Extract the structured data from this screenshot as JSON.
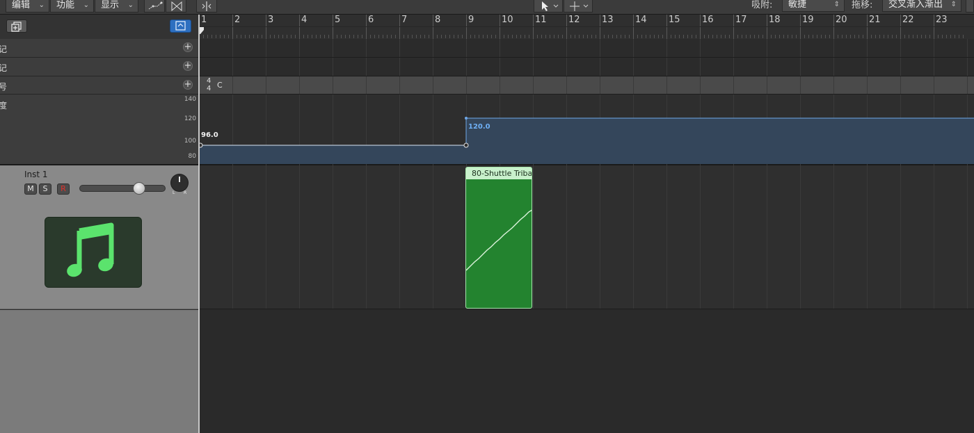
{
  "toolbar": {
    "menus": [
      {
        "label": "编辑"
      },
      {
        "label": "功能"
      },
      {
        "label": "显示"
      }
    ],
    "snap_label": "吸附:",
    "snap_value": "敏捷",
    "drag_label": "拖移:",
    "drag_value": "交叉渐入渐出"
  },
  "ruler": {
    "bars": [
      "1",
      "2",
      "3",
      "4",
      "5",
      "6",
      "7",
      "8",
      "9",
      "10",
      "11",
      "12",
      "13",
      "14",
      "15",
      "16",
      "17",
      "18",
      "19",
      "20",
      "21",
      "22",
      "23"
    ]
  },
  "global_tracks": {
    "row1_label": "记",
    "row2_label": "记",
    "row3_label": "号",
    "row4_label": "度",
    "signature_top": "4",
    "signature_bottom": "4",
    "key": "C",
    "tempo_ticks": [
      "140",
      "120",
      "100",
      "80"
    ],
    "tempo_start": "96.0",
    "tempo_change": "120.0"
  },
  "track": {
    "name": "Inst 1",
    "mute": "M",
    "solo": "S",
    "record": "R",
    "pan_left": "L",
    "pan_right": "R",
    "volume_level": 0.86
  },
  "region": {
    "name": "80-Shuttle Triba"
  },
  "colors": {
    "region_fill": "#23832f",
    "tempo_line": "#6fa8e8",
    "record_red": "#e0302a",
    "icon_green": "#5be36d"
  }
}
